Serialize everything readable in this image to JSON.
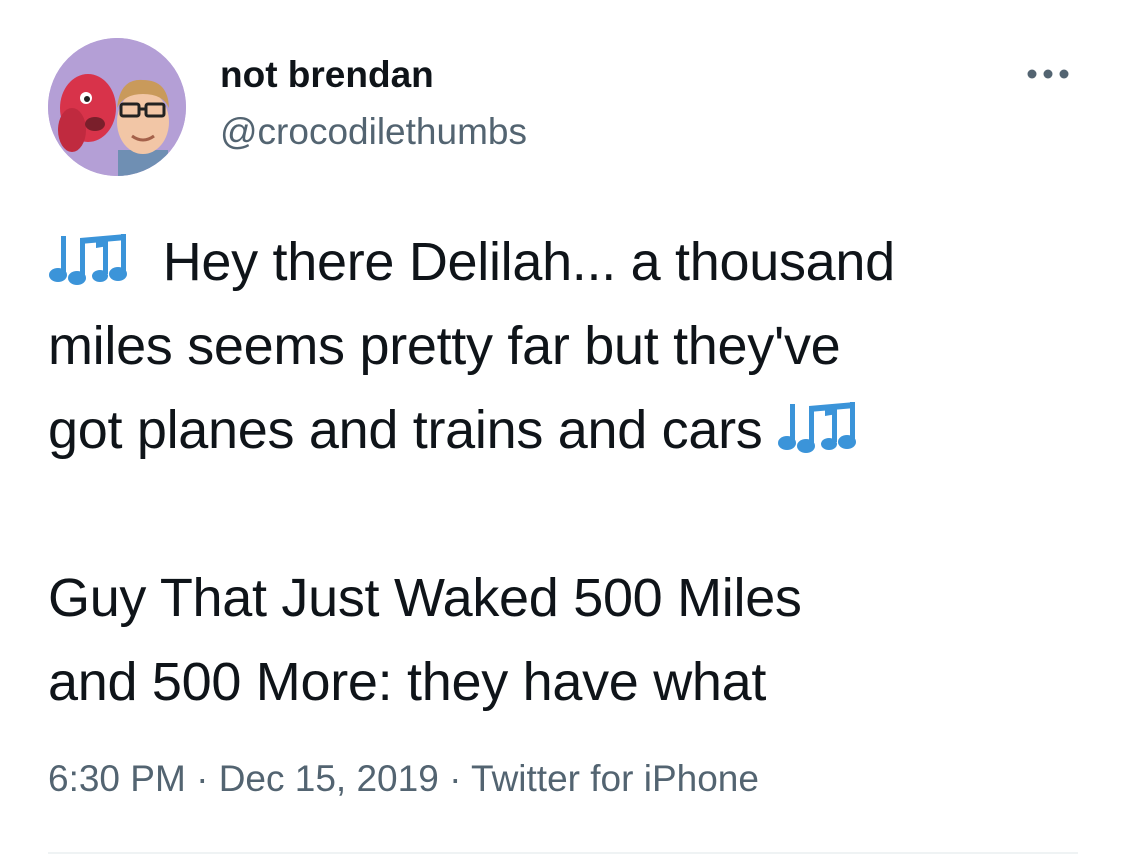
{
  "user": {
    "display_name": "not brendan",
    "handle": "@crocodilethumbs"
  },
  "menu": {
    "more_icon": "more-horizontal-icon"
  },
  "tweet": {
    "lines_1": [
      "Hey there Delilah... a thousand",
      "miles seems pretty far but they've",
      "got planes and trains and cars"
    ],
    "lines_2": [
      "Guy That Just Waked 500 Miles",
      "and 500 More: they have what"
    ],
    "emoji": "notes-emoji",
    "emoji_color": "#3b94d9"
  },
  "meta": {
    "time": "6:30 PM",
    "separator": "·",
    "date": "Dec 15, 2019",
    "source": "Twitter for iPhone"
  },
  "colors": {
    "text_primary": "#0f1419",
    "text_secondary": "#536471",
    "avatar_background": "#b49fd6",
    "divider": "#eff3f4"
  }
}
